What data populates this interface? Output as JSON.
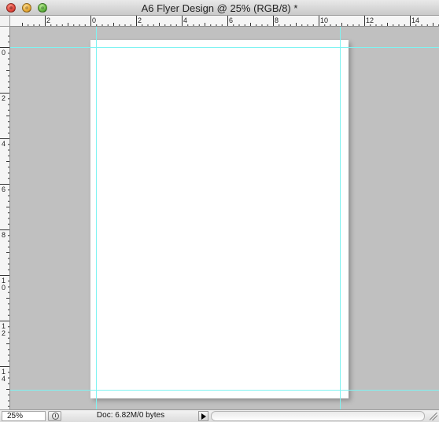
{
  "window": {
    "title": "A6 Flyer Design @ 25% (RGB/8) *"
  },
  "rulers": {
    "top_labels": [
      "2",
      "0",
      "2",
      "4",
      "6",
      "8",
      "10",
      "12",
      "14"
    ],
    "left_labels": [
      "0",
      "2",
      "4",
      "6",
      "8",
      "10",
      "12",
      "14"
    ],
    "unit_label": "inches"
  },
  "canvas": {
    "pasteboard_color": "#c0c0c0",
    "page_color": "#ffffff",
    "guide_color": "#7ff3f2"
  },
  "status": {
    "zoom": "25%",
    "doc_info": "Doc: 6.82M/0 bytes"
  },
  "icons": {
    "close": "close-button-icon",
    "minimize": "minimize-button-icon",
    "zoom": "zoom-button-icon",
    "history": "stopwatch-icon",
    "arrow": "play-arrow-icon",
    "resize": "resize-grip-icon"
  }
}
